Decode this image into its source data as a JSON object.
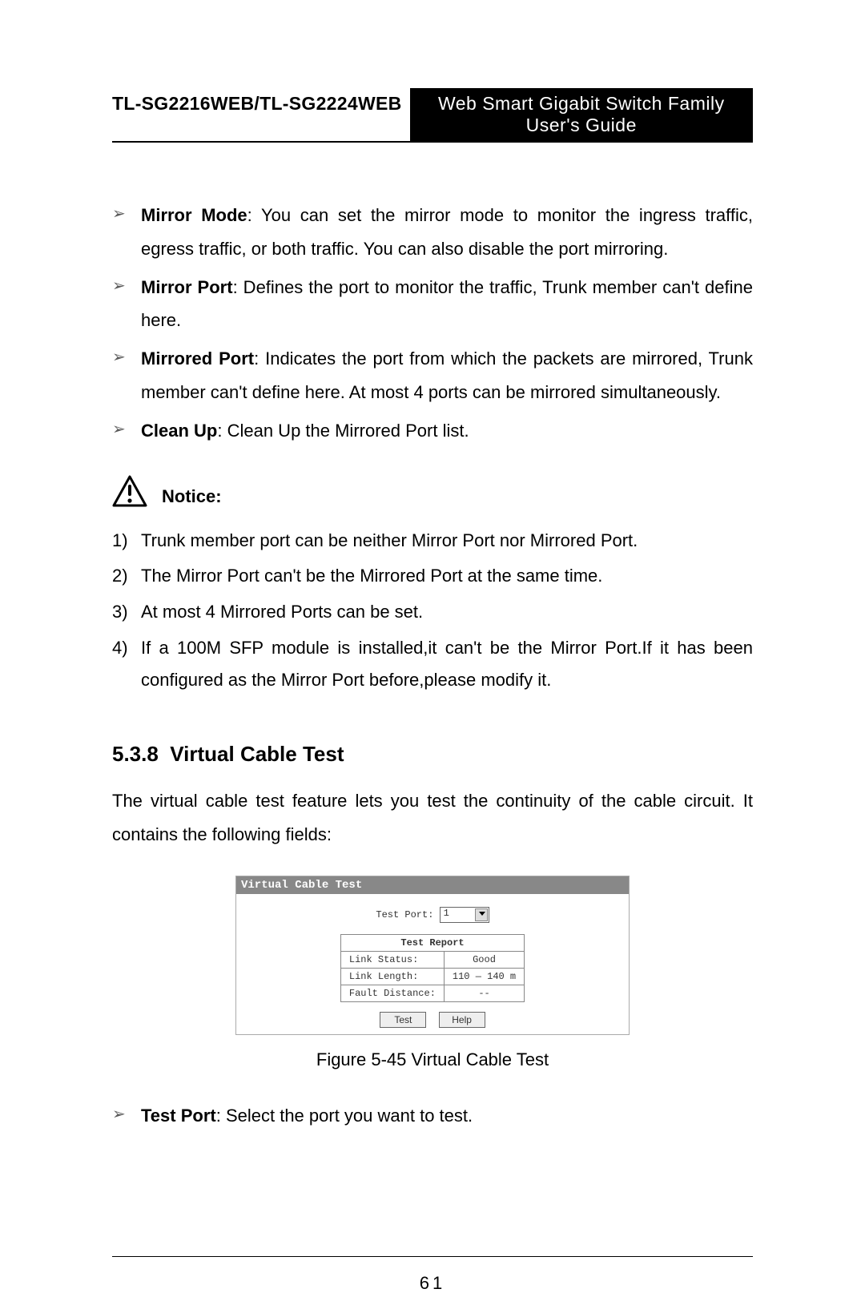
{
  "header": {
    "left": "TL-SG2216WEB/TL-SG2224WEB",
    "right": "Web Smart Gigabit Switch Family User's Guide"
  },
  "defs": [
    {
      "term": "Mirror Mode",
      "desc": ": You can set the mirror mode to monitor the ingress traffic, egress traffic, or both traffic. You can also disable the port mirroring."
    },
    {
      "term": "Mirror Port",
      "desc": ": Defines the port to monitor the traffic, Trunk member can't define here."
    },
    {
      "term": "Mirrored Port",
      "desc": ": Indicates the port from which the packets are mirrored, Trunk member can't define here. At most 4 ports can be mirrored simultaneously."
    },
    {
      "term": "Clean Up",
      "desc": ": Clean Up the Mirrored Port list."
    }
  ],
  "notice": {
    "title": "Notice:",
    "items": [
      "Trunk member port can be neither Mirror Port nor Mirrored Port.",
      "The Mirror Port can't be the Mirrored Port at the same time.",
      "At most 4 Mirrored Ports can be set.",
      " If a 100M SFP module is installed,it can't be the Mirror Port.If it has been configured as the Mirror Port before,please modify it."
    ]
  },
  "section": {
    "number": "5.3.8",
    "title": "Virtual Cable Test",
    "intro": "The virtual cable test feature lets you test the continuity of the cable circuit. It contains the following fields:"
  },
  "vct": {
    "panelTitle": "Virtual Cable Test",
    "testPortLabel": "Test Port:",
    "testPortValue": "1",
    "reportHeader": "Test Report",
    "rows": [
      {
        "label": "Link Status:",
        "value": "Good"
      },
      {
        "label": "Link Length:",
        "value": "110 — 140 m"
      },
      {
        "label": "Fault Distance:",
        "value": "--"
      }
    ],
    "buttons": {
      "test": "Test",
      "help": "Help"
    }
  },
  "figure": {
    "caption": "Figure 5-45  Virtual Cable Test"
  },
  "defs2": [
    {
      "term": "Test Port",
      "desc": ": Select the port you want to test."
    }
  ],
  "pageNumber": "61"
}
